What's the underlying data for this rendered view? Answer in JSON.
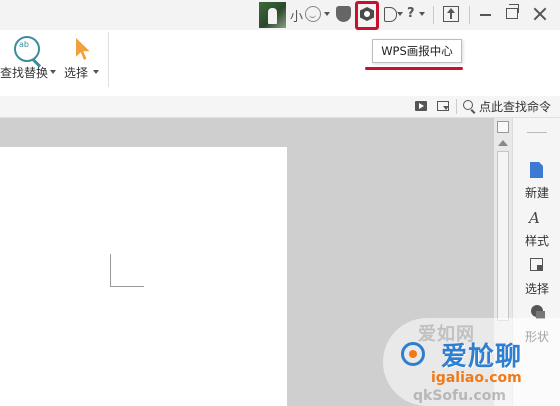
{
  "title_bar": {
    "user_label": "小",
    "help_label": "?",
    "tooltip_text": "WPS画报中心"
  },
  "ribbon": {
    "find_replace_label": "查找替换",
    "select_label": "选择"
  },
  "toolbar2": {
    "command_search_label": "点此查找命令"
  },
  "task_pane": {
    "items": [
      {
        "label": "新建",
        "icon": "new-doc-icon"
      },
      {
        "label": "样式",
        "icon": "style-icon"
      },
      {
        "label": "选择",
        "icon": "select-icon"
      },
      {
        "label": "形状",
        "icon": "shape-icon"
      }
    ]
  },
  "watermark": {
    "ghost_text": "爱如网",
    "title": "爱尬聊",
    "url": "igaliao.com",
    "url2": "qkSofu.com"
  },
  "colors": {
    "highlight_red": "#c8102e",
    "accent_blue": "#3d7bd3",
    "cursor_orange": "#f0a03c"
  }
}
